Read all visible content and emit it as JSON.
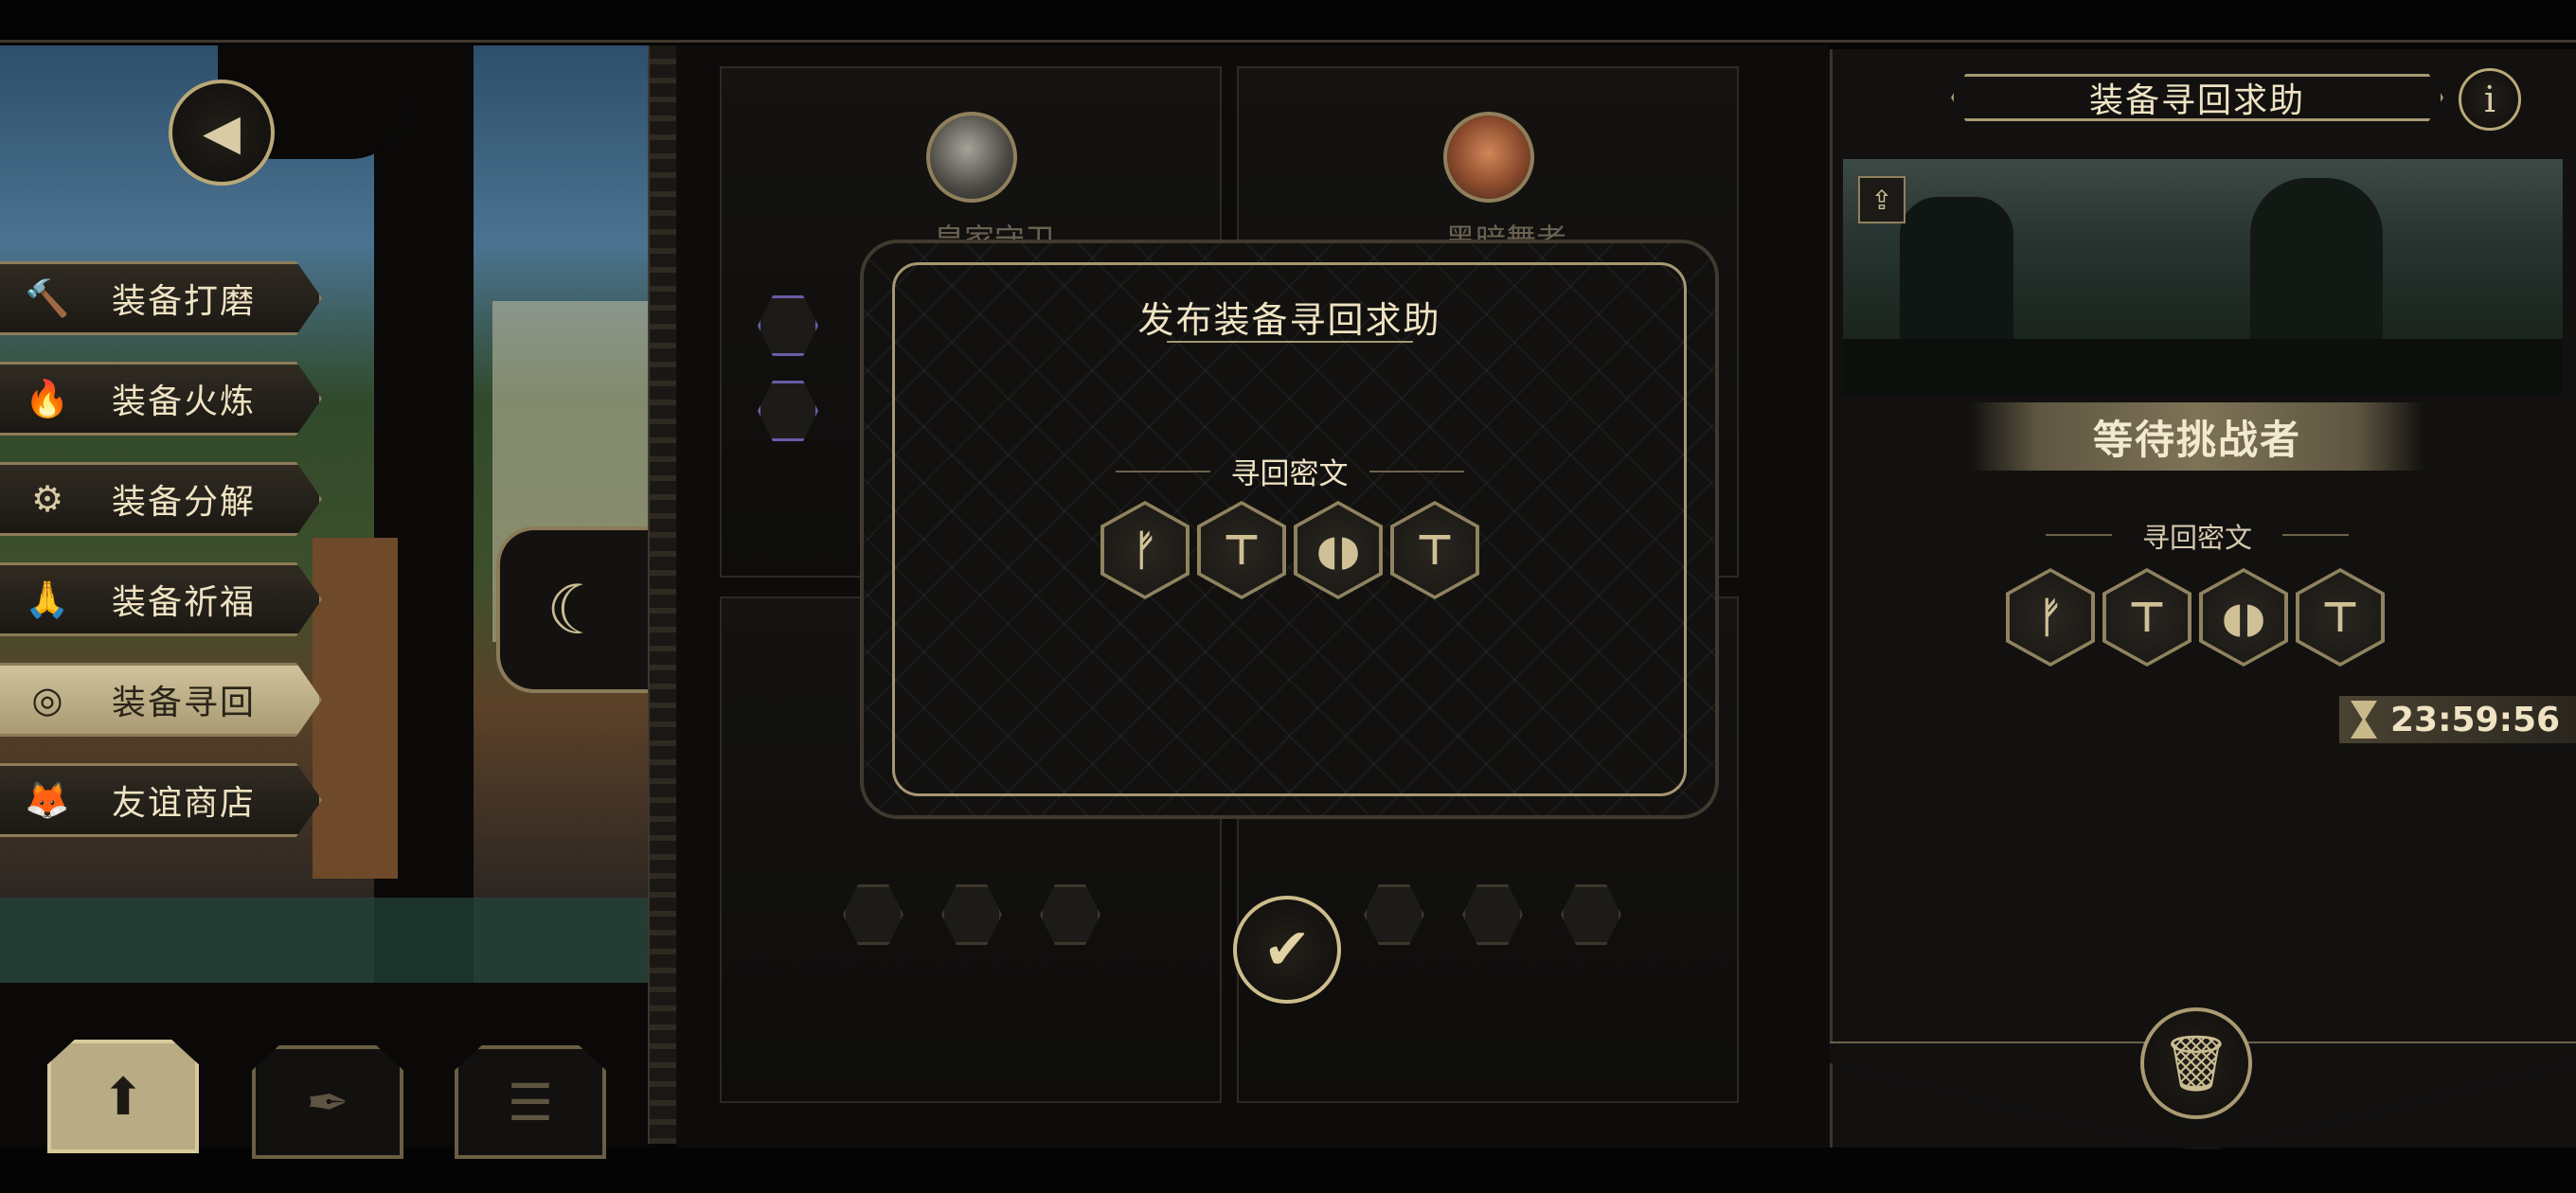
{
  "menu": {
    "items": [
      {
        "label": "装备打磨",
        "icon": "hammer-icon",
        "glyph": "🔨"
      },
      {
        "label": "装备火炼",
        "icon": "flame-icon",
        "glyph": "🔥"
      },
      {
        "label": "装备分解",
        "icon": "disassemble-icon",
        "glyph": "⚙"
      },
      {
        "label": "装备祈福",
        "icon": "pray-icon",
        "glyph": "🙏"
      },
      {
        "label": "装备寻回",
        "icon": "target-icon",
        "glyph": "◎"
      },
      {
        "label": "友谊商店",
        "icon": "fox-icon",
        "glyph": "🦊"
      }
    ],
    "active_index": 4
  },
  "back_button": {
    "icon": "back-arrow-icon",
    "glyph": "◀"
  },
  "moon_button": {
    "icon": "moon-icon",
    "glyph": "☾"
  },
  "bottom_tabs": [
    {
      "icon": "upload-icon",
      "glyph": "⬆"
    },
    {
      "icon": "feather-icon",
      "glyph": "✒"
    },
    {
      "icon": "list-icon",
      "glyph": "☰"
    }
  ],
  "cards": {
    "left_name": "皇家守卫",
    "right_name": "黑暗舞者"
  },
  "modal": {
    "title": "发布装备寻回求助",
    "section_label": "寻回密文",
    "runes": [
      "ᚠ",
      "⊤",
      "◖◗",
      "⊤"
    ]
  },
  "confirm_button": {
    "icon": "checkmark-icon",
    "glyph": "✔"
  },
  "right_panel": {
    "title": "装备寻回求助",
    "info_glyph": "i",
    "status": "等待挑战者",
    "section_label": "寻回密文",
    "runes": [
      "ᚠ",
      "⊤",
      "◖◗",
      "⊤"
    ],
    "timer": "23:59:56",
    "timer_icon": "hourglass-icon",
    "trash_icon": "trash-icon",
    "share_icon": "share-icon"
  },
  "colors": {
    "accent": "#b9a978",
    "panel": "#121110",
    "text": "#e9dcb8",
    "rune_slot": "#8f835f"
  }
}
